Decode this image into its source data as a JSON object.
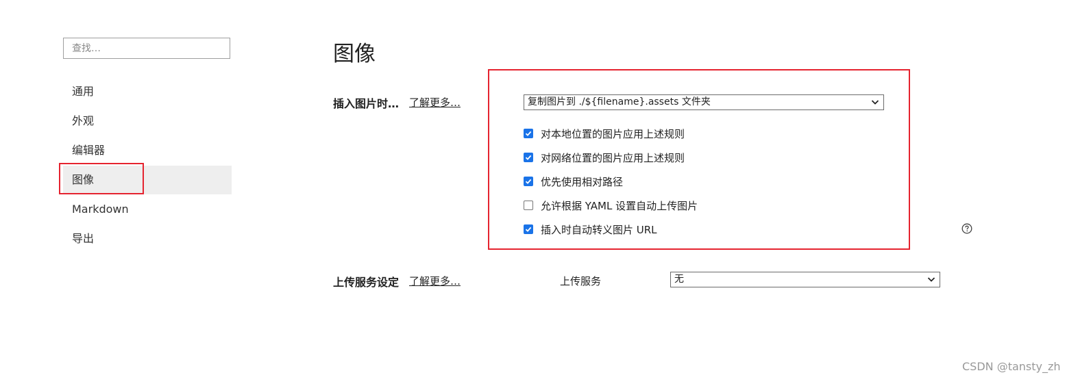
{
  "sidebar": {
    "search_placeholder": "查找…",
    "items": [
      {
        "label": "通用"
      },
      {
        "label": "外观"
      },
      {
        "label": "编辑器"
      },
      {
        "label": "图像"
      },
      {
        "label": "Markdown"
      },
      {
        "label": "导出"
      }
    ],
    "active_item": "图像"
  },
  "main": {
    "title": "图像",
    "insert_section": {
      "label": "插入图片时…",
      "learn_more": "了解更多…",
      "action_select": "复制图片到 ./${filename}.assets 文件夹",
      "options": [
        {
          "label": "对本地位置的图片应用上述规则",
          "checked": true
        },
        {
          "label": "对网络位置的图片应用上述规则",
          "checked": true
        },
        {
          "label": "优先使用相对路径",
          "checked": true
        },
        {
          "label": "允许根据 YAML 设置自动上传图片",
          "checked": false
        },
        {
          "label": "插入时自动转义图片 URL",
          "checked": true
        }
      ]
    },
    "upload_section": {
      "label": "上传服务设定",
      "learn_more": "了解更多…",
      "service_label": "上传服务",
      "service_select": "无"
    }
  },
  "watermark": "CSDN @tansty_zh",
  "colors": {
    "highlight": "#e5232f",
    "checkbox_accent": "#1a73e8",
    "active_bg": "#eeeeee"
  },
  "icons": {
    "chevron": "chevron-down-icon",
    "help": "question-circle-icon",
    "check": "checkmark-icon"
  }
}
